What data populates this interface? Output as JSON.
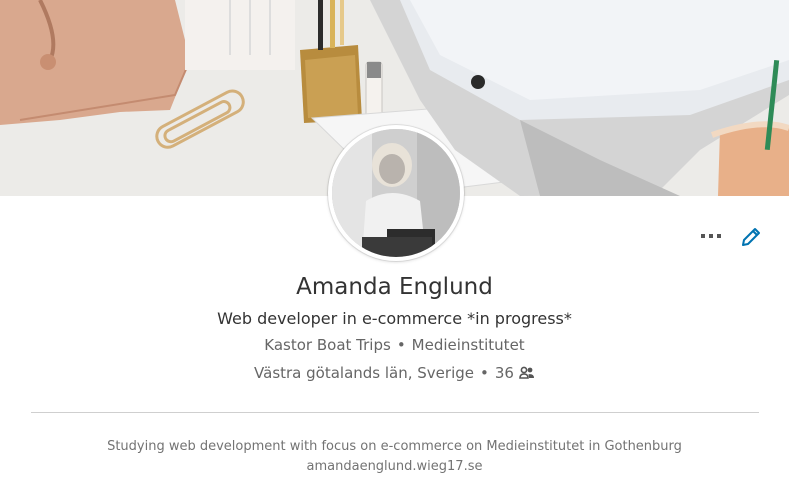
{
  "profile": {
    "name": "Amanda Englund",
    "headline": "Web developer in e-commerce *in progress*",
    "company": "Kastor Boat Trips",
    "school": "Medieinstitutet",
    "location": "Västra götalands län, Sverige",
    "connections": "36",
    "separator": "•",
    "summary": "Studying web development with focus on e-commerce on Medieinstitutet in Gothenburg",
    "website": "amandaenglund.wieg17.se"
  },
  "actions": {
    "more_icon": "ellipsis-icon",
    "edit_icon": "pencil-icon"
  },
  "icons": {
    "connections_icon": "people-icon"
  },
  "colors": {
    "accent": "#0073b1",
    "text_primary": "#333333",
    "text_secondary": "#666666",
    "divider": "#cfcfcf"
  }
}
